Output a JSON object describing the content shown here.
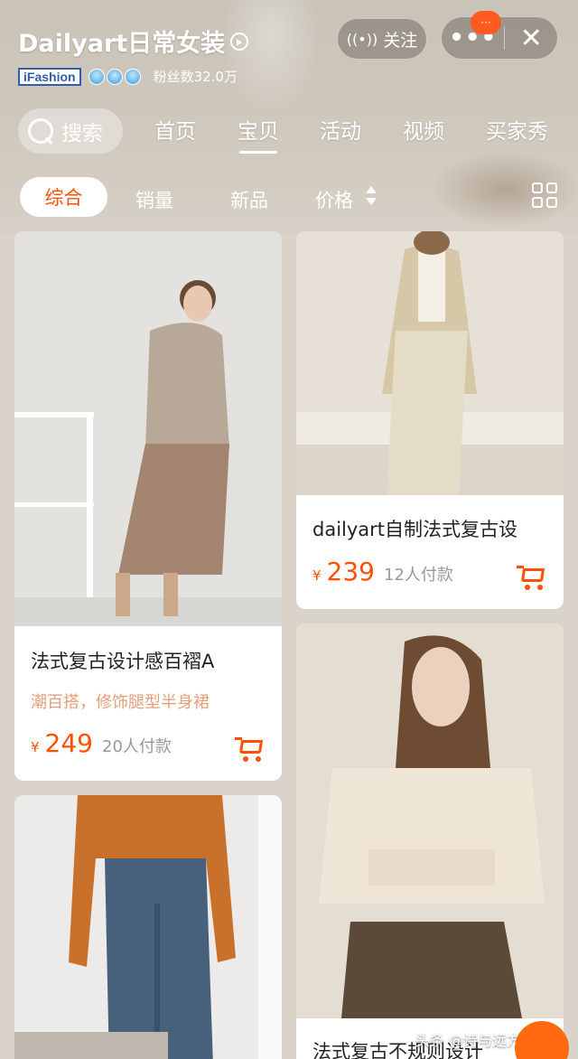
{
  "shop": {
    "name": "Dailyart日常女装",
    "badge": "iFashion",
    "fans": "粉丝数32.0万",
    "follow_label": "关注",
    "more_label": "•••",
    "close_label": "✕",
    "notification_dot": "···"
  },
  "nav": {
    "search_label": "搜索",
    "tabs": [
      {
        "label": "首页"
      },
      {
        "label": "宝贝",
        "active": true
      },
      {
        "label": "活动"
      },
      {
        "label": "视频"
      },
      {
        "label": "买家秀"
      }
    ]
  },
  "sort": {
    "items": [
      "综合",
      "销量",
      "新品",
      "价格"
    ],
    "selected": "综合"
  },
  "products": [
    {
      "title": "法式复古设计感百褶A",
      "subtitle": "潮百搭，修饰腿型半身裙",
      "currency": "¥",
      "price": "249",
      "paid": "20人付款"
    },
    {
      "title": "dailyart自制法式复古设",
      "currency": "¥",
      "price": "239",
      "paid": "12人付款"
    },
    {
      "title": ""
    },
    {
      "title": "法式复古不规则设计"
    }
  ],
  "watermark": "头条 @诗与远方的骗子",
  "colors": {
    "accent": "#ff5000",
    "subtitle": "#e4a07c"
  }
}
